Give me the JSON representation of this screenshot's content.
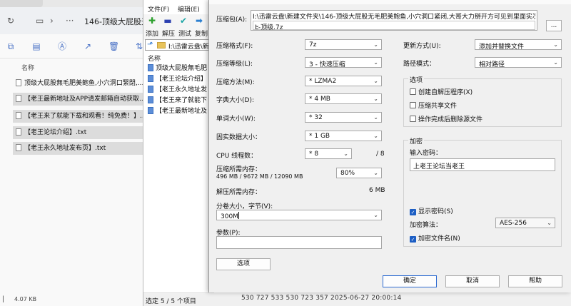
{
  "explorer": {
    "tab_title": "146-顶级大屁股无",
    "column_name": "名称",
    "files": [
      {
        "name": "顶级大屁股無毛肥美鲍鱼,小穴洞口緊閉,...",
        "selected": false
      },
      {
        "name": "【老王最新地址及APP请发邮箱自动获取...",
        "selected": true
      },
      {
        "name": "【老王来了就能下载和观看！纯免费！】...",
        "selected": true
      },
      {
        "name": "【老王论坛介绍】.txt",
        "selected": true
      },
      {
        "name": "【老王永久地址发布页】.txt",
        "selected": true
      }
    ],
    "status_size": "4.07 KB"
  },
  "filemanager": {
    "menus": [
      "文件(F)",
      "编辑(E)"
    ],
    "toolbar": [
      {
        "label": "添加",
        "icon": "add-icon"
      },
      {
        "label": "解压",
        "icon": "extract-icon"
      },
      {
        "label": "测试",
        "icon": "test-icon"
      },
      {
        "label": "复制",
        "icon": "copy-icon"
      }
    ],
    "path": "I:\\迅雷云盘\\新",
    "list_header": "名称",
    "files": [
      "顶级大屁股無毛肥",
      "【老王论坛介绍】",
      "【老王永久地址发",
      "【老王来了就能下",
      "【老王最新地址及"
    ],
    "status": "选定 5 / 5 个项目"
  },
  "background_status": "530 727 533    530 723 357    2025-06-27 20:00:14",
  "dialog": {
    "archive_label": "压缩包(A):",
    "archive_dir": "I:\\迅雷云盘\\新建文件夹\\146-顶级大屁股无毛肥美鲍鱼,小穴洞口紧闭,大哥大力掰开方可见到里面实况\\",
    "archive_name": "L-顶级.7z",
    "browse_label": "...",
    "format_label": "压缩格式(F):",
    "format_value": "7z",
    "level_label": "压缩等级(L):",
    "level_value": "3 - 快速压缩",
    "method_label": "压缩方法(M):",
    "method_value": "* LZMA2",
    "dict_label": "字典大小(D):",
    "dict_value": "* 4 MB",
    "word_label": "单词大小(W):",
    "word_value": "* 32",
    "solid_label": "固实数据大小：",
    "solid_value": "* 1 GB",
    "threads_label": "CPU 线程数：",
    "threads_value": "* 8",
    "threads_max": "/ 8",
    "mem_comp_label": "压缩所需内存：",
    "mem_comp_detail": "496 MB / 9672 MB / 12090 MB",
    "mem_comp_value": "80%",
    "mem_decomp_label": "解压所需内存：",
    "mem_decomp_value": "6 MB",
    "split_label": "分卷大小，字节(V):",
    "split_value": "300M",
    "params_label": "参数(P):",
    "params_value": "",
    "options_button": "选项",
    "update_label": "更新方式(U):",
    "update_value": "添加并替换文件",
    "pathmode_label": "路径模式：",
    "pathmode_value": "相对路径",
    "options_group": "选项",
    "opt_sfx": "创建自解压程序(X)",
    "opt_shared": "压缩共享文件",
    "opt_delete": "操作完成后删除源文件",
    "enc_group": "加密",
    "password_label": "输入密码：",
    "password_value": "上老王论坛当老王",
    "show_password": "显示密码(S)",
    "enc_method_label": "加密算法：",
    "enc_method_value": "AES-256",
    "enc_names": "加密文件名(N)",
    "ok": "确定",
    "cancel": "取消",
    "help": "帮助"
  }
}
